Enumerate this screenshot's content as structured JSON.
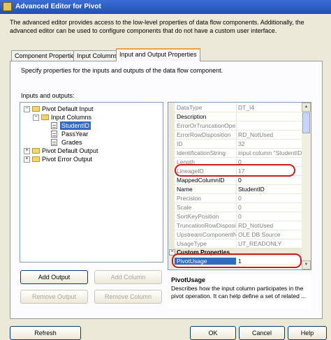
{
  "window": {
    "title": "Advanced Editor for Pivot"
  },
  "description": "The advanced editor provides access to the low-level properties of data flow components. Additionally, the advanced editor can be used to configure components that do not have a custom user interface.",
  "tabs": [
    {
      "label": "Component Properties",
      "active": false
    },
    {
      "label": "Input Columns",
      "active": false
    },
    {
      "label": "Input and Output Properties",
      "active": true
    }
  ],
  "panel": {
    "intro": "Specify properties for the inputs and outputs of the data flow component.",
    "tree_label": "Inputs and outputs:",
    "tree": {
      "input": "Pivot Default Input",
      "input_columns": "Input Columns",
      "columns": [
        "StudentID",
        "PassYear",
        "Grades"
      ],
      "selected": "StudentID",
      "output": "Pivot Default Output",
      "error_output": "Pivot Error Output"
    }
  },
  "properties": [
    {
      "name": "DataType",
      "value": "DT_I4",
      "gray": true
    },
    {
      "name": "Description",
      "value": "",
      "gray": false
    },
    {
      "name": "ErrorOrTruncationOpe",
      "value": "",
      "gray": true
    },
    {
      "name": "ErrorRowDisposition",
      "value": "RD_NotUsed",
      "gray": true
    },
    {
      "name": "ID",
      "value": "32",
      "gray": true
    },
    {
      "name": "IdentificationString",
      "value": "input column \"StudentID\" (",
      "gray": true
    },
    {
      "name": "Length",
      "value": "0",
      "gray": true
    },
    {
      "name": "LineageID",
      "value": "17",
      "gray": true
    },
    {
      "name": "MappedColumnID",
      "value": "0",
      "gray": false
    },
    {
      "name": "Name",
      "value": "StudentID",
      "gray": false
    },
    {
      "name": "Precision",
      "value": "0",
      "gray": true
    },
    {
      "name": "Scale",
      "value": "0",
      "gray": true
    },
    {
      "name": "SortKeyPosition",
      "value": "0",
      "gray": true
    },
    {
      "name": "TruncationRowDisposit",
      "value": "RD_NotUsed",
      "gray": true
    },
    {
      "name": "UpstreamComponentN",
      "value": "OLE DB Source",
      "gray": true
    },
    {
      "name": "UsageType",
      "value": "UT_READONLY",
      "gray": true
    }
  ],
  "custom_properties": {
    "category": "Custom Properties",
    "name": "PivotUsage",
    "value": "1"
  },
  "help": {
    "title": "PivotUsage",
    "text": "Describes how the input column participates in the pivot operation. It can help define a set of related ..."
  },
  "buttons": {
    "add_output": "Add Output",
    "add_column": "Add Column",
    "remove_output": "Remove Output",
    "remove_column": "Remove Column",
    "refresh": "Refresh",
    "ok": "OK",
    "cancel": "Cancel",
    "help": "Help"
  },
  "colors": {
    "selection": "#316ac5",
    "highlight_ring": "#c81c1c",
    "title_bar": "#2a5bc6"
  }
}
